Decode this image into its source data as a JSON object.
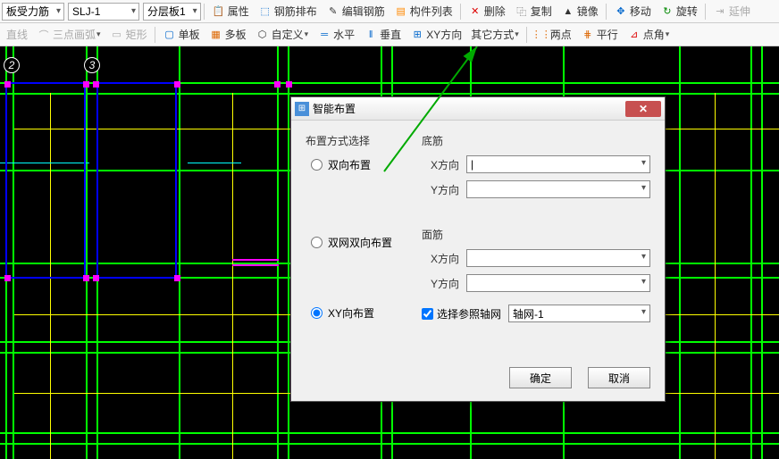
{
  "toolbar1": {
    "drop1": "板受力筋",
    "drop2": "SLJ-1",
    "drop3": "分层板1",
    "attrs": "属性",
    "rebar": "钢筋排布",
    "edit_rebar": "编辑钢筋",
    "component_list": "构件列表",
    "delete": "删除",
    "copy": "复制",
    "mirror": "镜像",
    "move": "移动",
    "rotate": "旋转",
    "extend": "延伸"
  },
  "toolbar2": {
    "line": "直线",
    "arc3": "三点画弧",
    "rect": "矩形",
    "single_board": "单板",
    "multi_board": "多板",
    "custom": "自定义",
    "horizontal": "水平",
    "vertical": "垂直",
    "xy_dir": "XY方向",
    "other": "其它方式",
    "two_point": "两点",
    "parallel": "平行",
    "point_angle": "点角"
  },
  "grid_bubbles": [
    "2",
    "3"
  ],
  "dialog": {
    "title": "智能布置",
    "group": "布置方式选择",
    "radio1": "双向布置",
    "radio2": "双网双向布置",
    "radio3": "XY向布置",
    "section_bottom": "底筋",
    "section_top": "面筋",
    "x_dir": "X方向",
    "y_dir": "Y方向",
    "ref_grid_check": "选择参照轴网",
    "ref_grid_value": "轴网-1",
    "ok": "确定",
    "cancel": "取消"
  }
}
